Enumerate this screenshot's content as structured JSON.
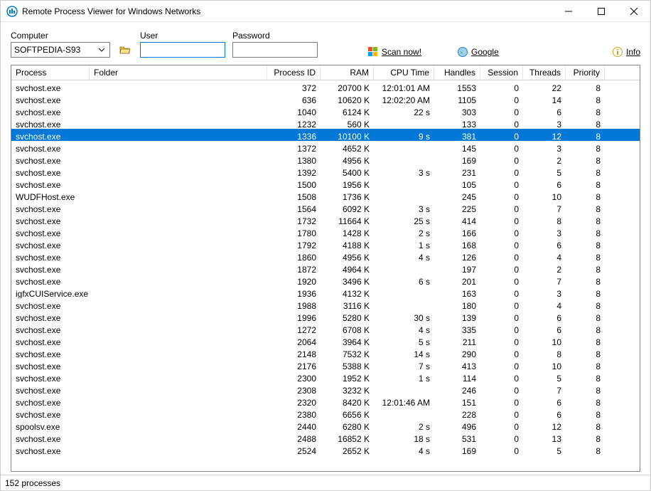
{
  "window": {
    "title": "Remote Process Viewer for Windows Networks"
  },
  "toolbar": {
    "computer_label": "Computer",
    "computer_value": "SOFTPEDIA-S93",
    "user_label": "User",
    "user_value": "",
    "password_label": "Password",
    "password_value": "",
    "scan_label": "Scan now!",
    "google_label": "Google",
    "info_label": "Info"
  },
  "columns": {
    "process": "Process",
    "folder": "Folder",
    "pid": "Process ID",
    "ram": "RAM",
    "cpu": "CPU Time",
    "handles": "Handles",
    "session": "Session",
    "threads": "Threads",
    "priority": "Priority"
  },
  "rows": [
    {
      "process": "svchost.exe",
      "folder": "",
      "pid": "372",
      "ram": "20700 K",
      "cpu": "12:01:01 AM",
      "handles": "1553",
      "session": "0",
      "threads": "22",
      "priority": "8",
      "selected": false
    },
    {
      "process": "svchost.exe",
      "folder": "",
      "pid": "636",
      "ram": "10620 K",
      "cpu": "12:02:20 AM",
      "handles": "1105",
      "session": "0",
      "threads": "14",
      "priority": "8",
      "selected": false
    },
    {
      "process": "svchost.exe",
      "folder": "",
      "pid": "1040",
      "ram": "6124 K",
      "cpu": "22 s",
      "handles": "303",
      "session": "0",
      "threads": "6",
      "priority": "8",
      "selected": false
    },
    {
      "process": "svchost.exe",
      "folder": "",
      "pid": "1232",
      "ram": "560 K",
      "cpu": "",
      "handles": "133",
      "session": "0",
      "threads": "3",
      "priority": "8",
      "selected": false
    },
    {
      "process": "svchost.exe",
      "folder": "",
      "pid": "1336",
      "ram": "10100 K",
      "cpu": "9 s",
      "handles": "381",
      "session": "0",
      "threads": "12",
      "priority": "8",
      "selected": true
    },
    {
      "process": "svchost.exe",
      "folder": "",
      "pid": "1372",
      "ram": "4652 K",
      "cpu": "",
      "handles": "145",
      "session": "0",
      "threads": "3",
      "priority": "8",
      "selected": false
    },
    {
      "process": "svchost.exe",
      "folder": "",
      "pid": "1380",
      "ram": "4956 K",
      "cpu": "",
      "handles": "169",
      "session": "0",
      "threads": "2",
      "priority": "8",
      "selected": false
    },
    {
      "process": "svchost.exe",
      "folder": "",
      "pid": "1392",
      "ram": "5400 K",
      "cpu": "3 s",
      "handles": "231",
      "session": "0",
      "threads": "5",
      "priority": "8",
      "selected": false
    },
    {
      "process": "svchost.exe",
      "folder": "",
      "pid": "1500",
      "ram": "1956 K",
      "cpu": "",
      "handles": "105",
      "session": "0",
      "threads": "6",
      "priority": "8",
      "selected": false
    },
    {
      "process": "WUDFHost.exe",
      "folder": "",
      "pid": "1508",
      "ram": "1736 K",
      "cpu": "",
      "handles": "245",
      "session": "0",
      "threads": "10",
      "priority": "8",
      "selected": false
    },
    {
      "process": "svchost.exe",
      "folder": "",
      "pid": "1564",
      "ram": "6092 K",
      "cpu": "3 s",
      "handles": "225",
      "session": "0",
      "threads": "7",
      "priority": "8",
      "selected": false
    },
    {
      "process": "svchost.exe",
      "folder": "",
      "pid": "1732",
      "ram": "11664 K",
      "cpu": "25 s",
      "handles": "414",
      "session": "0",
      "threads": "8",
      "priority": "8",
      "selected": false
    },
    {
      "process": "svchost.exe",
      "folder": "",
      "pid": "1780",
      "ram": "1428 K",
      "cpu": "2 s",
      "handles": "166",
      "session": "0",
      "threads": "3",
      "priority": "8",
      "selected": false
    },
    {
      "process": "svchost.exe",
      "folder": "",
      "pid": "1792",
      "ram": "4188 K",
      "cpu": "1 s",
      "handles": "168",
      "session": "0",
      "threads": "6",
      "priority": "8",
      "selected": false
    },
    {
      "process": "svchost.exe",
      "folder": "",
      "pid": "1860",
      "ram": "4956 K",
      "cpu": "4 s",
      "handles": "126",
      "session": "0",
      "threads": "4",
      "priority": "8",
      "selected": false
    },
    {
      "process": "svchost.exe",
      "folder": "",
      "pid": "1872",
      "ram": "4964 K",
      "cpu": "",
      "handles": "197",
      "session": "0",
      "threads": "2",
      "priority": "8",
      "selected": false
    },
    {
      "process": "svchost.exe",
      "folder": "",
      "pid": "1920",
      "ram": "3496 K",
      "cpu": "6 s",
      "handles": "201",
      "session": "0",
      "threads": "7",
      "priority": "8",
      "selected": false
    },
    {
      "process": "igfxCUIService.exe",
      "folder": "",
      "pid": "1936",
      "ram": "4132 K",
      "cpu": "",
      "handles": "163",
      "session": "0",
      "threads": "3",
      "priority": "8",
      "selected": false
    },
    {
      "process": "svchost.exe",
      "folder": "",
      "pid": "1988",
      "ram": "3116 K",
      "cpu": "",
      "handles": "180",
      "session": "0",
      "threads": "4",
      "priority": "8",
      "selected": false
    },
    {
      "process": "svchost.exe",
      "folder": "",
      "pid": "1996",
      "ram": "5280 K",
      "cpu": "30 s",
      "handles": "139",
      "session": "0",
      "threads": "6",
      "priority": "8",
      "selected": false
    },
    {
      "process": "svchost.exe",
      "folder": "",
      "pid": "1272",
      "ram": "6708 K",
      "cpu": "4 s",
      "handles": "335",
      "session": "0",
      "threads": "6",
      "priority": "8",
      "selected": false
    },
    {
      "process": "svchost.exe",
      "folder": "",
      "pid": "2064",
      "ram": "3964 K",
      "cpu": "5 s",
      "handles": "211",
      "session": "0",
      "threads": "10",
      "priority": "8",
      "selected": false
    },
    {
      "process": "svchost.exe",
      "folder": "",
      "pid": "2148",
      "ram": "7532 K",
      "cpu": "14 s",
      "handles": "290",
      "session": "0",
      "threads": "8",
      "priority": "8",
      "selected": false
    },
    {
      "process": "svchost.exe",
      "folder": "",
      "pid": "2176",
      "ram": "5388 K",
      "cpu": "7 s",
      "handles": "413",
      "session": "0",
      "threads": "10",
      "priority": "8",
      "selected": false
    },
    {
      "process": "svchost.exe",
      "folder": "",
      "pid": "2300",
      "ram": "1952 K",
      "cpu": "1 s",
      "handles": "114",
      "session": "0",
      "threads": "5",
      "priority": "8",
      "selected": false
    },
    {
      "process": "svchost.exe",
      "folder": "",
      "pid": "2308",
      "ram": "3232 K",
      "cpu": "",
      "handles": "246",
      "session": "0",
      "threads": "7",
      "priority": "8",
      "selected": false
    },
    {
      "process": "svchost.exe",
      "folder": "",
      "pid": "2320",
      "ram": "8420 K",
      "cpu": "12:01:46 AM",
      "handles": "151",
      "session": "0",
      "threads": "6",
      "priority": "8",
      "selected": false
    },
    {
      "process": "svchost.exe",
      "folder": "",
      "pid": "2380",
      "ram": "6656 K",
      "cpu": "",
      "handles": "228",
      "session": "0",
      "threads": "6",
      "priority": "8",
      "selected": false
    },
    {
      "process": "spoolsv.exe",
      "folder": "",
      "pid": "2440",
      "ram": "6280 K",
      "cpu": "2 s",
      "handles": "496",
      "session": "0",
      "threads": "12",
      "priority": "8",
      "selected": false
    },
    {
      "process": "svchost.exe",
      "folder": "",
      "pid": "2488",
      "ram": "16852 K",
      "cpu": "18 s",
      "handles": "531",
      "session": "0",
      "threads": "13",
      "priority": "8",
      "selected": false
    },
    {
      "process": "svchost.exe",
      "folder": "",
      "pid": "2524",
      "ram": "2652 K",
      "cpu": "4 s",
      "handles": "169",
      "session": "0",
      "threads": "5",
      "priority": "8",
      "selected": false
    }
  ],
  "statusbar": {
    "text": "152 processes"
  }
}
